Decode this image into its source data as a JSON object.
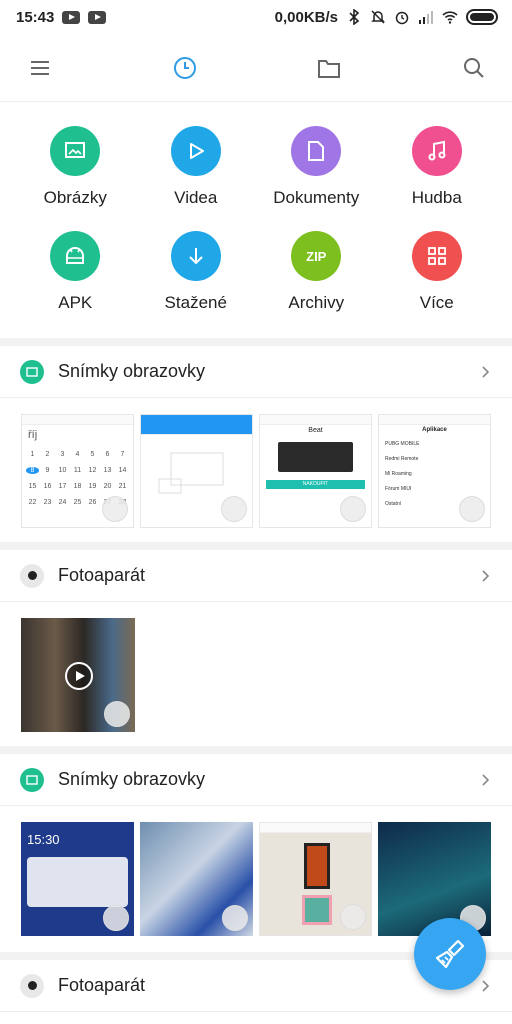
{
  "status_bar": {
    "time": "15:43",
    "network_speed": "0,00KB/s"
  },
  "toolbar": {
    "icons": [
      "menu-icon",
      "recent-clock-icon",
      "folder-icon",
      "search-icon"
    ]
  },
  "categories": [
    {
      "label": "Obrázky",
      "color": "#1fbf8f",
      "icon": "image-icon"
    },
    {
      "label": "Videa",
      "color": "#1fa7e8",
      "icon": "play-icon"
    },
    {
      "label": "Dokumenty",
      "color": "#a076e6",
      "icon": "document-icon"
    },
    {
      "label": "Hudba",
      "color": "#f0508f",
      "icon": "music-icon"
    },
    {
      "label": "APK",
      "color": "#1fbf8f",
      "icon": "android-icon"
    },
    {
      "label": "Stažené",
      "color": "#1fa7e8",
      "icon": "download-icon"
    },
    {
      "label": "Archivy",
      "color": "#7cbf1f",
      "icon": "zip-icon",
      "badge": "ZIP"
    },
    {
      "label": "Více",
      "color": "#f05050",
      "icon": "grid-icon"
    }
  ],
  "sections": [
    {
      "title": "Snímky obrazovky",
      "type": "screenshots"
    },
    {
      "title": "Fotoaparát",
      "type": "camera"
    },
    {
      "title": "Snímky obrazovky",
      "type": "screenshots"
    },
    {
      "title": "Fotoaparát",
      "type": "camera"
    }
  ],
  "thumbs_first": {
    "calendar_month": "říj",
    "shop_title": "Beat",
    "shop_button": "NAKOUPIT",
    "apps_title": "Aplikace",
    "apps": [
      "PUBG MOBILE",
      "Redmi Remote",
      "Mi Roaming",
      "Fórum MIUI",
      "Ostatní"
    ]
  },
  "thumbs_third": {
    "lock_time": "15:30"
  }
}
